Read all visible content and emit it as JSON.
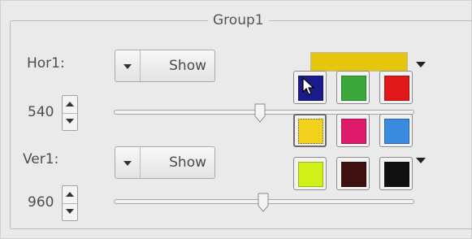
{
  "group": {
    "title": "Group1"
  },
  "horizontal": {
    "label": "Hor1:",
    "visibility": "Show",
    "value": "540",
    "slider_fraction": 0.49
  },
  "vertical": {
    "label": "Ver1:",
    "visibility": "Show",
    "value": "960",
    "slider_fraction": 0.5
  },
  "colors": {
    "current_color": "#e6c60a",
    "palette": [
      {
        "name": "navy",
        "color": "#1a1a8c",
        "selected": false,
        "has_cursor": true
      },
      {
        "name": "green",
        "color": "#3aa83a",
        "selected": false
      },
      {
        "name": "red",
        "color": "#e01818",
        "selected": false
      },
      {
        "name": "yellow",
        "color": "#f2d21c",
        "selected": true
      },
      {
        "name": "magenta",
        "color": "#e01a6a",
        "selected": false
      },
      {
        "name": "blue",
        "color": "#3a8ae0",
        "selected": false
      },
      {
        "name": "lime",
        "color": "#d0f018",
        "selected": false
      },
      {
        "name": "brown",
        "color": "#3e1010",
        "selected": false
      },
      {
        "name": "black",
        "color": "#111111",
        "selected": false
      }
    ]
  }
}
